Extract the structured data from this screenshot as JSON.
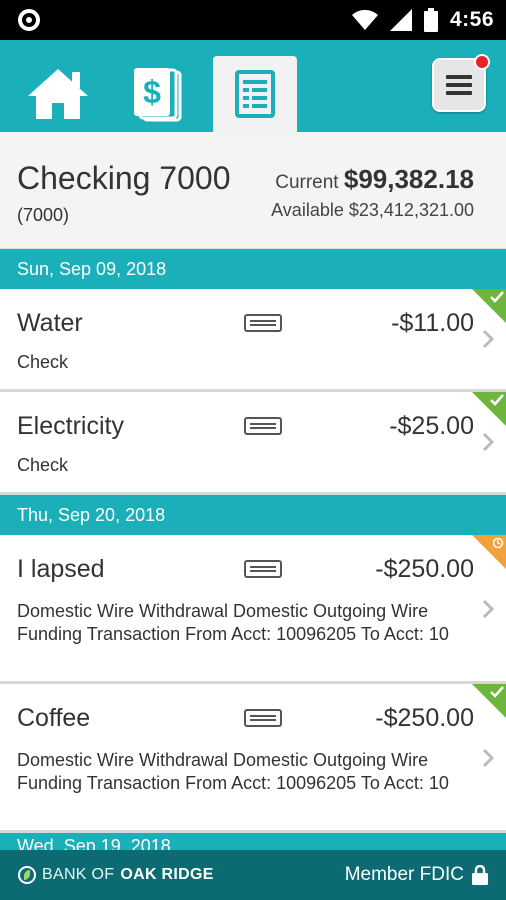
{
  "status_bar": {
    "time": "4:56"
  },
  "nav": {
    "tabs": [
      {
        "icon": "home-icon"
      },
      {
        "icon": "dollar-cards-icon"
      },
      {
        "icon": "activity-list-icon",
        "active": true
      }
    ],
    "menu_icon": "hamburger-menu-icon",
    "notification": true
  },
  "account": {
    "name": "Checking 7000",
    "number": "(7000)",
    "current_label": "Current",
    "current_amount": "$99,382.18",
    "available_label": "Available",
    "available_amount": "$23,412,321.00"
  },
  "groups": [
    {
      "date": "Sun, Sep 09, 2018",
      "transactions": [
        {
          "name": "Water",
          "type": "Check",
          "amount": "-$11.00",
          "status": "cleared"
        },
        {
          "name": "Electricity",
          "type": "Check",
          "amount": "-$25.00",
          "status": "cleared"
        }
      ]
    },
    {
      "date": "Thu, Sep 20, 2018",
      "transactions": [
        {
          "name": "I lapsed",
          "description": "Domestic Wire Withdrawal  Domestic Outgoing Wire Funding Transaction From Acct: 10096205 To Acct: 10",
          "amount": "-$250.00",
          "status": "pending"
        },
        {
          "name": "Coffee",
          "description": "Domestic Wire Withdrawal  Domestic Outgoing Wire Funding Transaction From Acct: 10096205 To Acct: 10",
          "amount": "-$250.00",
          "status": "cleared"
        }
      ]
    },
    {
      "date": "Wed, Sep 19, 2018"
    }
  ],
  "footer": {
    "bank_prefix": "BANK OF",
    "bank_name": "OAK RIDGE",
    "fdic": "Member FDIC"
  },
  "colors": {
    "teal": "#1bafba",
    "dark_teal": "#0c6a73",
    "cleared": "#6db53d",
    "pending": "#f2a23a",
    "notification": "#e0262d"
  }
}
